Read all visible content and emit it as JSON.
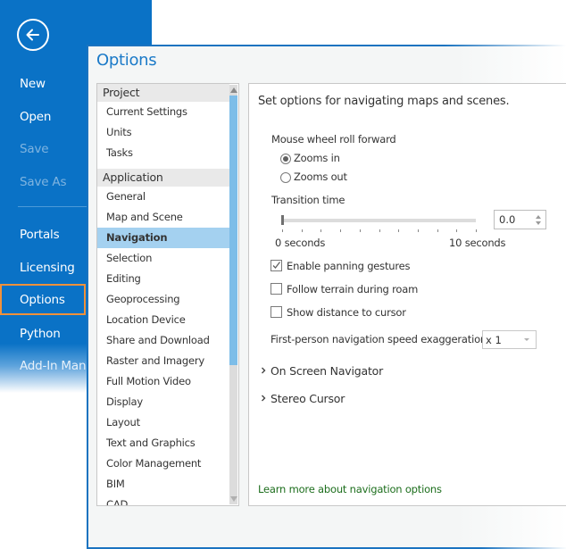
{
  "backstage": {
    "back_icon": "arrow-left-circle-icon",
    "items": [
      {
        "label": "New",
        "state": "enabled"
      },
      {
        "label": "Open",
        "state": "enabled"
      },
      {
        "label": "Save",
        "state": "disabled"
      },
      {
        "label": "Save As",
        "state": "disabled"
      },
      {
        "label": "Portals",
        "state": "enabled"
      },
      {
        "label": "Licensing",
        "state": "enabled"
      },
      {
        "label": "Options",
        "state": "highlighted"
      },
      {
        "label": "Python",
        "state": "enabled"
      },
      {
        "label": "Add-In Man",
        "state": "enabled"
      }
    ],
    "highlight_color": "#f0913a",
    "background_color": "#0a72c6"
  },
  "dialog": {
    "title": "Options",
    "categories": {
      "groups": [
        {
          "label": "Project",
          "items": [
            "Current Settings",
            "Units",
            "Tasks"
          ]
        },
        {
          "label": "Application",
          "items": [
            "General",
            "Map and Scene",
            "Navigation",
            "Selection",
            "Editing",
            "Geoprocessing",
            "Location Device",
            "Share and Download",
            "Raster and Imagery",
            "Full Motion Video",
            "Display",
            "Layout",
            "Text and Graphics",
            "Color Management",
            "BIM",
            "CAD"
          ]
        }
      ],
      "selected": "Navigation"
    },
    "panel": {
      "heading": "Set options for navigating maps and scenes.",
      "mouse_wheel": {
        "label": "Mouse wheel roll forward",
        "options": [
          {
            "label": "Zooms in",
            "checked": true
          },
          {
            "label": "Zooms out",
            "checked": false
          }
        ]
      },
      "transition": {
        "label": "Transition time",
        "min_label": "0 seconds",
        "max_label": "10 seconds",
        "value": "0.0",
        "slider_value": 0,
        "slider_min": 0,
        "slider_max": 10
      },
      "checkboxes": [
        {
          "label": "Enable panning gestures",
          "checked": true
        },
        {
          "label": "Follow terrain during roam",
          "checked": false
        },
        {
          "label": "Show distance to cursor",
          "checked": false
        }
      ],
      "speed": {
        "label": "First-person navigation speed exaggeration",
        "value": "x 1"
      },
      "expanders": [
        "On Screen Navigator",
        "Stereo Cursor"
      ],
      "learn_more": "Learn more about navigation options"
    }
  }
}
